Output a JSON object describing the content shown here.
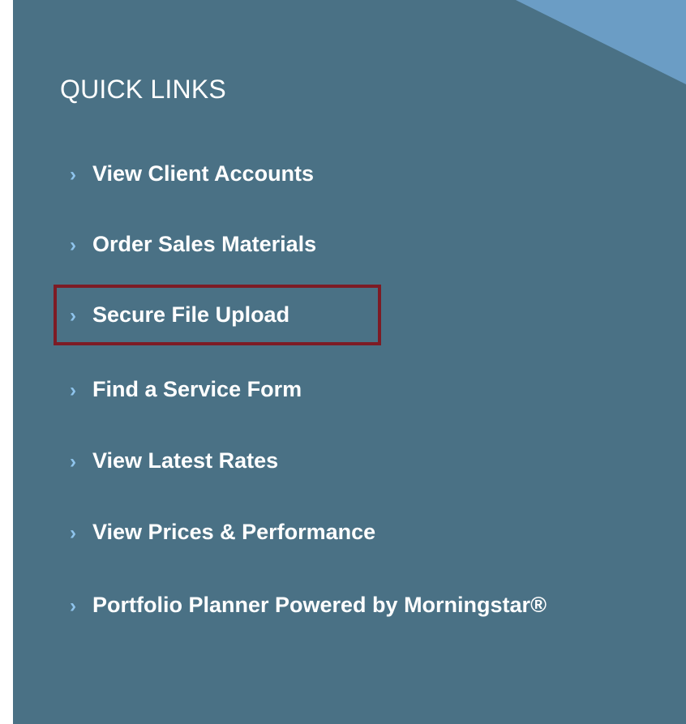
{
  "quick_links": {
    "title": "QUICK LINKS",
    "chevron": "›",
    "highlight_color": "#7d1b25",
    "items": [
      {
        "label": "View Client Accounts"
      },
      {
        "label": "Order Sales Materials"
      },
      {
        "label": "Secure File Upload",
        "highlighted": true
      },
      {
        "label": "Find a Service Form"
      },
      {
        "label": "View Latest Rates"
      },
      {
        "label": "View Prices & Performance"
      },
      {
        "label": "Portfolio Planner Powered by Morningstar®"
      }
    ]
  },
  "colors": {
    "panel_background": "#4a7185",
    "corner_accent": "#6b9dc5",
    "chevron": "#8fc4ec",
    "text": "#ffffff"
  }
}
